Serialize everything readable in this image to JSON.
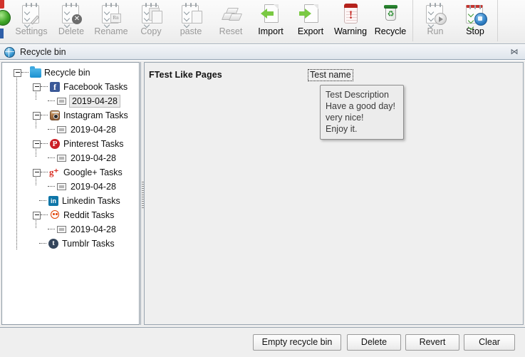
{
  "toolbar": {
    "buttons": [
      {
        "label": "Settings",
        "icon": "note-pencil-icon",
        "enabled": false
      },
      {
        "label": "Delete",
        "icon": "note-delete-icon",
        "enabled": false
      },
      {
        "label": "Rename",
        "icon": "note-rename-icon",
        "enabled": false
      },
      {
        "label": "Copy",
        "icon": "note-copy-icon",
        "enabled": false
      },
      {
        "label": "paste",
        "icon": "note-paste-icon",
        "enabled": false
      },
      {
        "label": "Reset",
        "icon": "eraser-icon",
        "enabled": false
      },
      {
        "label": "Import",
        "icon": "import-arrow-icon",
        "enabled": true
      },
      {
        "label": "Export",
        "icon": "export-arrow-icon",
        "enabled": true
      },
      {
        "label": "Warning",
        "icon": "warning-note-icon",
        "enabled": true
      },
      {
        "label": "Recycle",
        "icon": "recycle-bin-icon",
        "enabled": true
      },
      {
        "label": "Run",
        "icon": "note-run-icon",
        "enabled": false
      },
      {
        "label": "Stop",
        "icon": "note-stop-icon",
        "enabled": true
      }
    ]
  },
  "window": {
    "title": "Recycle bin",
    "title_icon": "globe-icon",
    "close_icon": "close-icon"
  },
  "tree": {
    "nodes": [
      {
        "label": "Recycle bin",
        "icon": "folder-icon",
        "level": 0,
        "expander": "minus",
        "selected": false
      },
      {
        "label": "Facebook Tasks",
        "icon": "facebook-icon",
        "level": 1,
        "expander": "minus",
        "selected": false
      },
      {
        "label": "2019-04-28",
        "icon": "date-item-icon",
        "level": 2,
        "expander": "none",
        "selected": true
      },
      {
        "label": "Instagram Tasks",
        "icon": "instagram-icon",
        "level": 1,
        "expander": "minus",
        "selected": false
      },
      {
        "label": "2019-04-28",
        "icon": "date-item-icon",
        "level": 2,
        "expander": "none",
        "selected": false
      },
      {
        "label": "Pinterest Tasks",
        "icon": "pinterest-icon",
        "level": 1,
        "expander": "minus",
        "selected": false
      },
      {
        "label": "2019-04-28",
        "icon": "date-item-icon",
        "level": 2,
        "expander": "none",
        "selected": false
      },
      {
        "label": "Google+ Tasks",
        "icon": "googleplus-icon",
        "level": 1,
        "expander": "minus",
        "selected": false
      },
      {
        "label": "2019-04-28",
        "icon": "date-item-icon",
        "level": 2,
        "expander": "none",
        "selected": false
      },
      {
        "label": "Linkedin Tasks",
        "icon": "linkedin-icon",
        "level": 1,
        "expander": "none",
        "selected": false
      },
      {
        "label": "Reddit Tasks",
        "icon": "reddit-icon",
        "level": 1,
        "expander": "minus",
        "selected": false
      },
      {
        "label": "2019-04-28",
        "icon": "date-item-icon",
        "level": 2,
        "expander": "none",
        "selected": false
      },
      {
        "label": "Tumblr Tasks",
        "icon": "tumblr-icon",
        "level": 1,
        "expander": "none",
        "selected": false
      }
    ]
  },
  "content": {
    "pages_label": "FTest Like Pages",
    "test_name": "Test name",
    "description_lines": [
      "Test Description",
      "Have a good day!",
      "very nice!",
      "Enjoy it."
    ]
  },
  "footer": {
    "empty_recycle_bin": "Empty recycle bin",
    "delete": "Delete",
    "revert": "Revert",
    "clear": "Clear"
  }
}
